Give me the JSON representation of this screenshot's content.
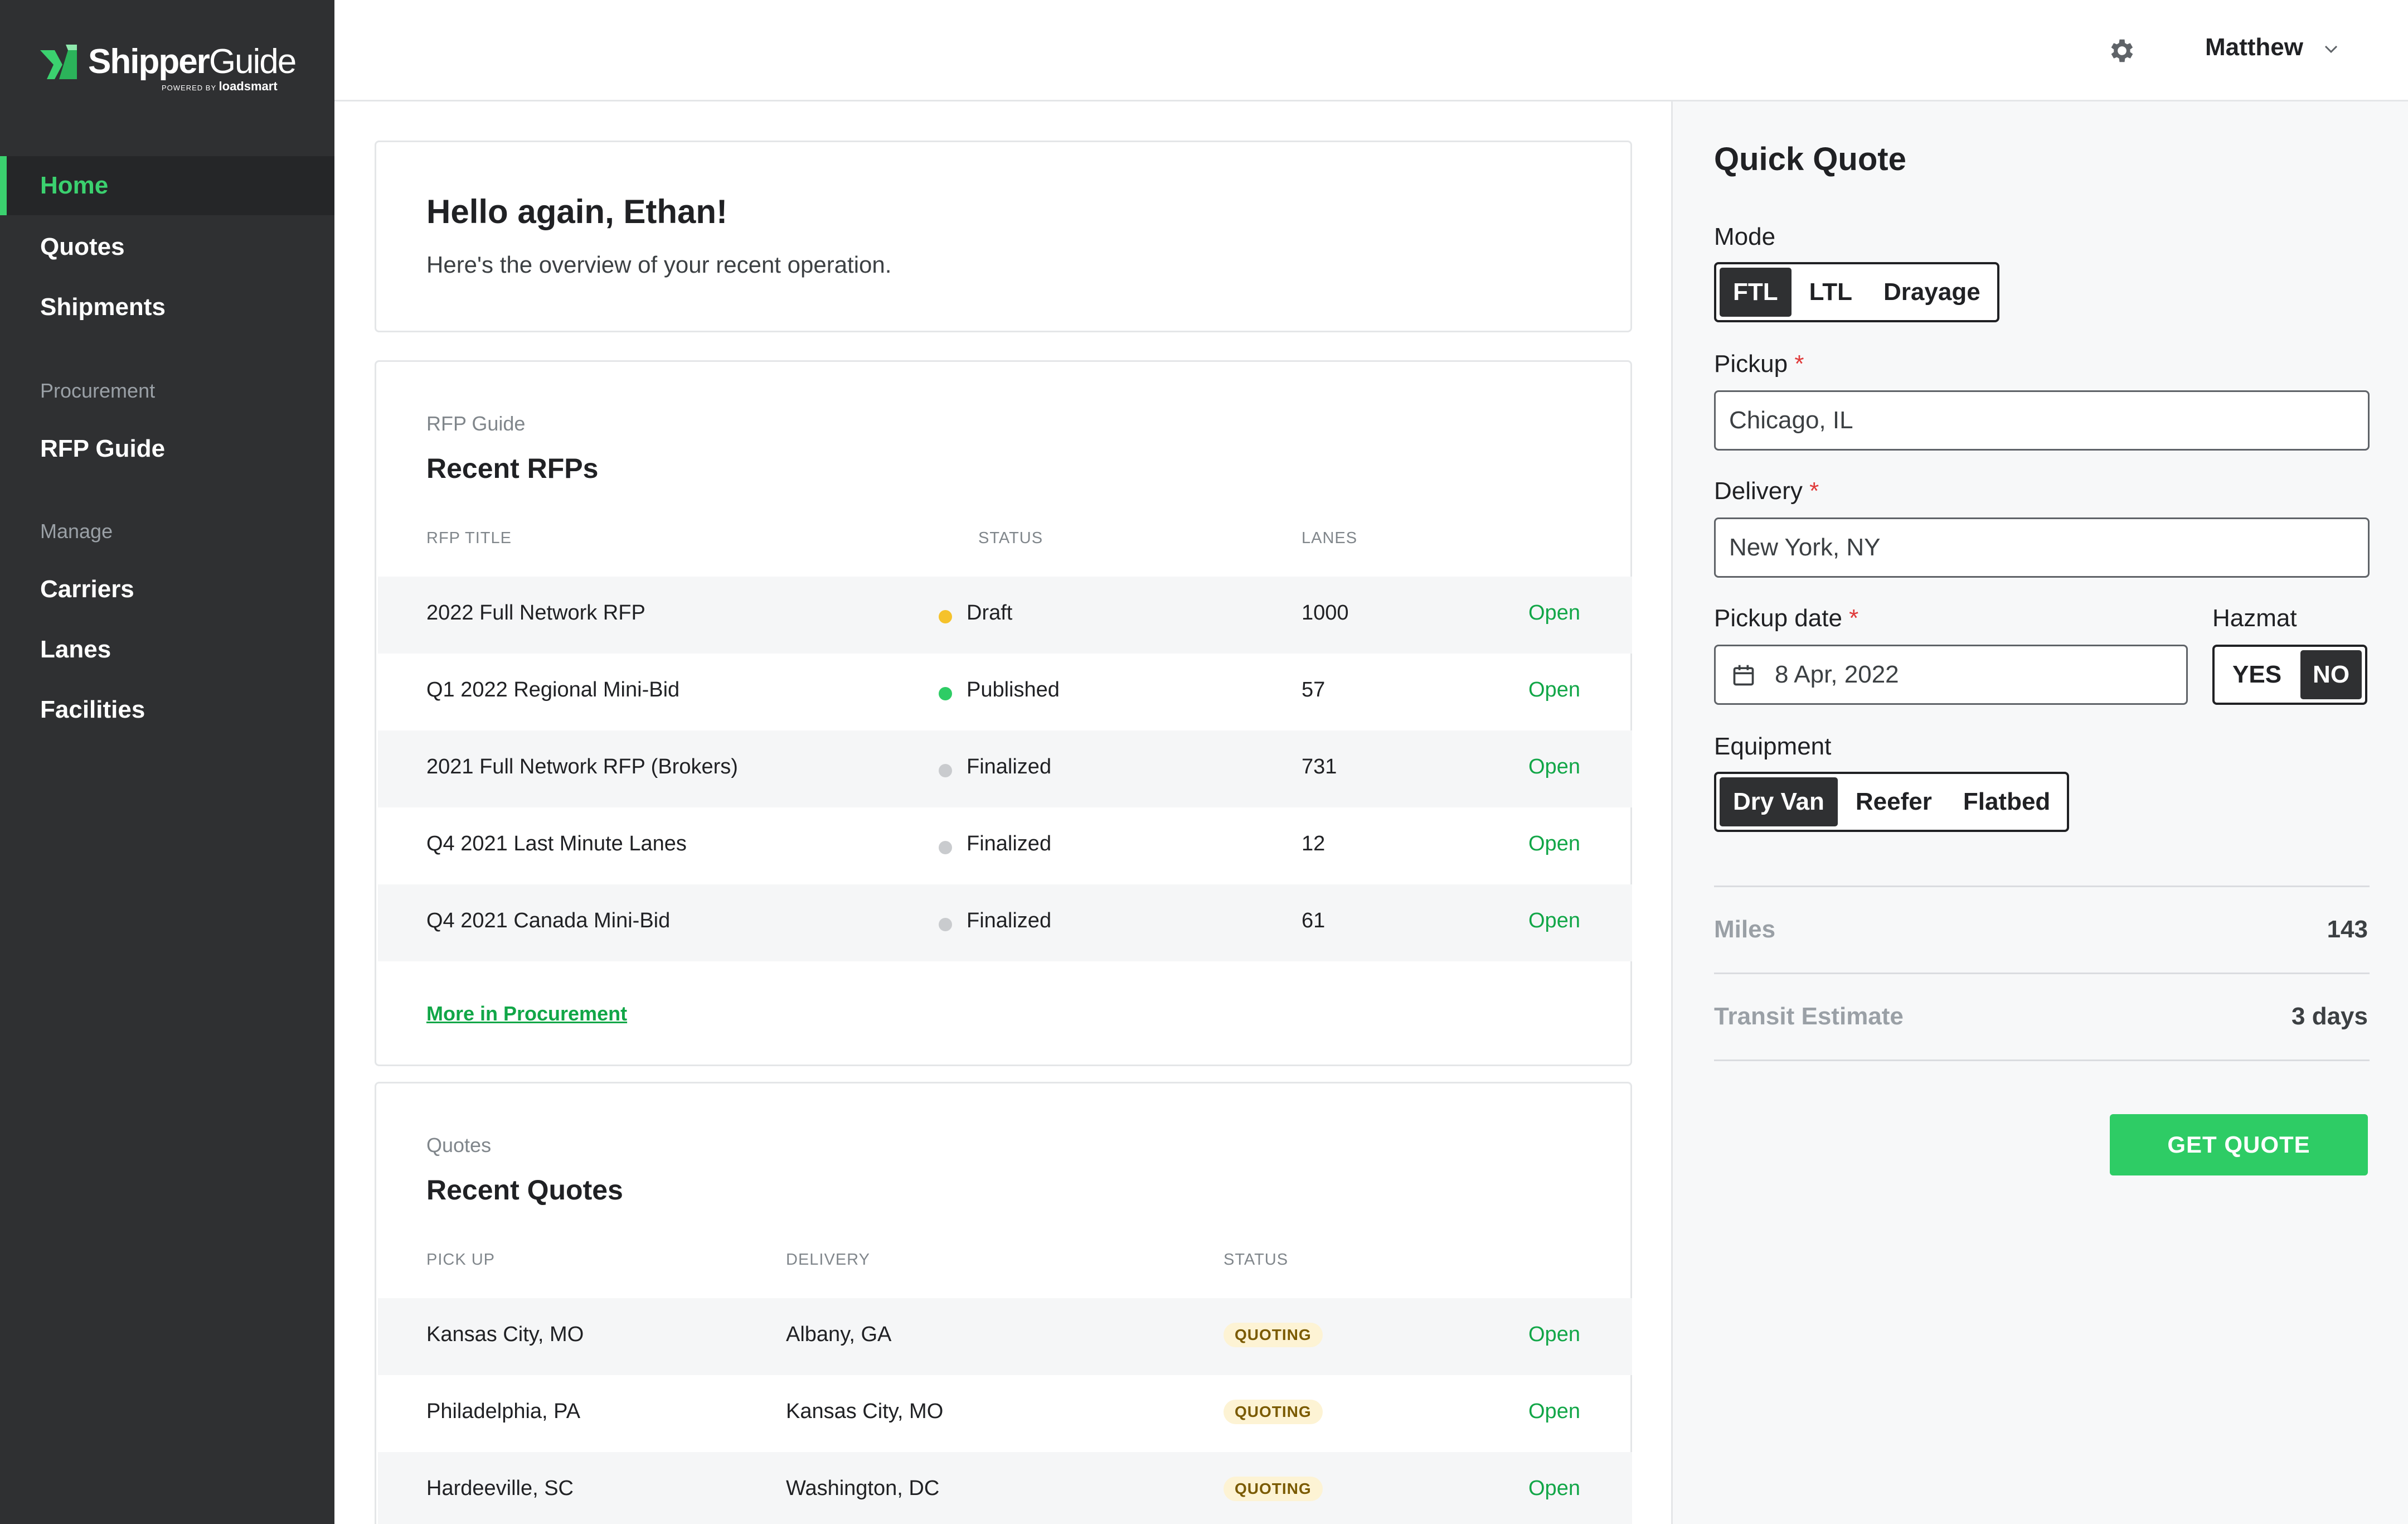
{
  "brand": {
    "name_bold": "Shipper",
    "name_light": "Guide",
    "powered_by": "POWERED BY",
    "powered_brand": "loadsmart",
    "accent": "#3bd16f"
  },
  "sidebar": {
    "items": [
      {
        "label": "Home",
        "active": true
      },
      {
        "label": "Quotes"
      },
      {
        "label": "Shipments"
      }
    ],
    "procurement_heading": "Procurement",
    "procurement_items": [
      {
        "label": "RFP Guide"
      }
    ],
    "manage_heading": "Manage",
    "manage_items": [
      {
        "label": "Carriers"
      },
      {
        "label": "Lanes"
      },
      {
        "label": "Facilities"
      }
    ]
  },
  "header": {
    "settings_icon": "gear-icon",
    "user_name": "Matthew",
    "user_menu_icon": "chevron-down-icon"
  },
  "greeting": {
    "title": "Hello again, Ethan!",
    "subtitle": "Here's the overview of your recent operation."
  },
  "rfps": {
    "kicker": "RFP Guide",
    "title": "Recent RFPs",
    "columns": [
      "RFP TITLE",
      "STATUS",
      "LANES"
    ],
    "rows": [
      {
        "title": "2022 Full Network RFP",
        "status": "Draft",
        "status_color": "#f5c22b",
        "lanes": "1000",
        "action": "Open"
      },
      {
        "title": "Q1 2022 Regional Mini-Bid",
        "status": "Published",
        "status_color": "#2ecc65",
        "lanes": "57",
        "action": "Open"
      },
      {
        "title": "2021 Full Network RFP (Brokers)",
        "status": "Finalized",
        "status_color": "#c9cbce",
        "lanes": "731",
        "action": "Open"
      },
      {
        "title": "Q4 2021 Last Minute Lanes",
        "status": "Finalized",
        "status_color": "#c9cbce",
        "lanes": "12",
        "action": "Open"
      },
      {
        "title": "Q4 2021 Canada Mini-Bid",
        "status": "Finalized",
        "status_color": "#c9cbce",
        "lanes": "61",
        "action": "Open"
      }
    ],
    "more_link": "More in Procurement"
  },
  "quotes": {
    "kicker": "Quotes",
    "title": "Recent Quotes",
    "columns": [
      "PICK UP",
      "DELIVERY",
      "STATUS"
    ],
    "rows": [
      {
        "pickup": "Kansas City, MO",
        "delivery": "Albany, GA",
        "status": "QUOTING",
        "action": "Open"
      },
      {
        "pickup": "Philadelphia, PA",
        "delivery": "Kansas City, MO",
        "status": "QUOTING",
        "action": "Open"
      },
      {
        "pickup": "Hardeeville, SC",
        "delivery": "Washington, DC",
        "status": "QUOTING",
        "action": "Open"
      }
    ]
  },
  "quick_quote": {
    "title": "Quick Quote",
    "mode_label": "Mode",
    "modes": [
      "FTL",
      "LTL",
      "Drayage"
    ],
    "selected_mode": "FTL",
    "pickup_label": "Pickup",
    "pickup_value": "Chicago, IL",
    "delivery_label": "Delivery",
    "delivery_value": "New York, NY",
    "required_mark": "*",
    "date_label": "Pickup date",
    "date_value": "8 Apr, 2022",
    "calendar_icon": "calendar-icon",
    "hazmat_label": "Hazmat",
    "hazmat_options": [
      "YES",
      "NO"
    ],
    "hazmat_selected": "NO",
    "equipment_label": "Equipment",
    "equipment_options": [
      "Dry Van",
      "Reefer",
      "Flatbed"
    ],
    "equipment_selected": "Dry Van",
    "miles_label": "Miles",
    "miles_value": "143",
    "transit_label": "Transit Estimate",
    "transit_value": "3 days",
    "cta": "GET QUOTE",
    "cta_color": "#2ecc65"
  }
}
